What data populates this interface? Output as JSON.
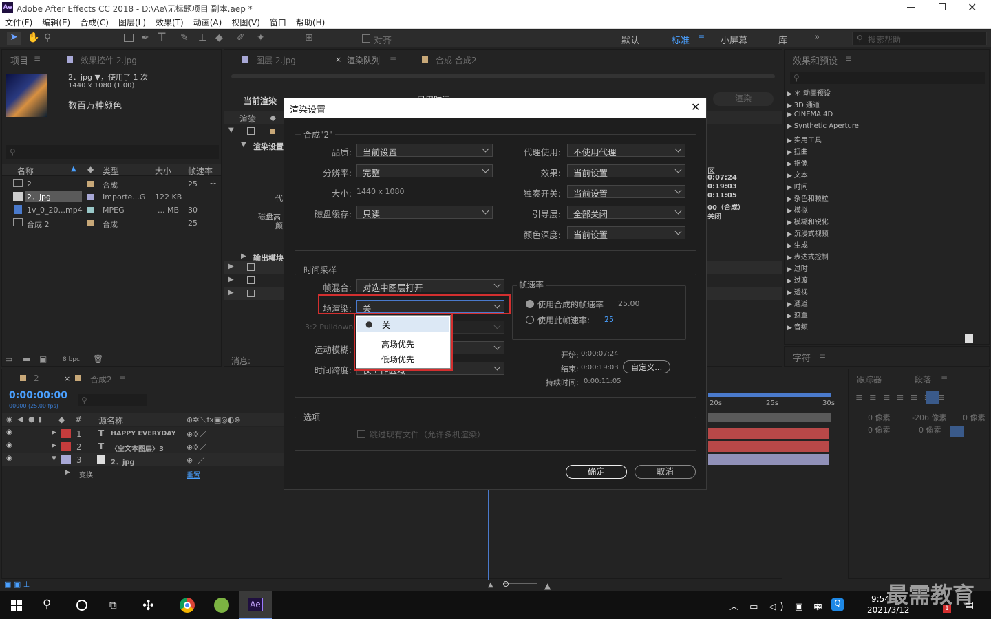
{
  "window": {
    "title": "Adobe After Effects CC 2018 - D:\\Ae\\无标题项目 副本.aep *",
    "app_icon": "Ae"
  },
  "menu": [
    "文件(F)",
    "编辑(E)",
    "合成(C)",
    "图层(L)",
    "效果(T)",
    "动画(A)",
    "视图(V)",
    "窗口",
    "帮助(H)"
  ],
  "toolbar": {
    "align_label": "对齐",
    "workspaces": [
      "默认",
      "标准",
      "小屏幕",
      "库"
    ],
    "search_placeholder": "搜索帮助"
  },
  "project_panel": {
    "tab": "项目",
    "effects_tab": "效果控件 2.jpg",
    "item_name": "2．jpg ▼，使用了 1 次",
    "item_dims": "1440 x 1080 (1.00)",
    "item_colors": "数百万种颜色",
    "columns": [
      "名称",
      "类型",
      "大小",
      "帧速率"
    ],
    "rows": [
      {
        "name": "2",
        "type": "合成",
        "size": "",
        "fps": "25"
      },
      {
        "name": "2．jpg",
        "type": "Importe...G",
        "size": "122 KB",
        "fps": ""
      },
      {
        "name": "1v_0_20...mp4",
        "type": "MPEG",
        "size": "... MB",
        "fps": "30"
      },
      {
        "name": "合成 2",
        "type": "合成",
        "size": "",
        "fps": "25"
      }
    ],
    "bpc": "8 bpc"
  },
  "center_tabs": {
    "layer": "图层 2.jpg",
    "render_queue": "渲染队列",
    "comp": "合成 合成2"
  },
  "render_queue": {
    "current": "当前渲染",
    "render_col": "渲染",
    "render_settings": "渲染设置",
    "output_module": "输出模块",
    "render_btn": "渲染",
    "elapsed": "已用时间",
    "msg_label": "消息:",
    "proxy": "代",
    "disk": "磁盘高",
    "color": "颜"
  },
  "rq_right": {
    "area": "区",
    "t1": "0:07:24",
    "t2": "0:19:03",
    "t3": "0:11:05",
    "t4": "00（合成）",
    "t5": "关闭"
  },
  "effects_panel": {
    "tab": "效果和预设",
    "items": [
      "＊ 动画预设",
      "3D 通道",
      "CINEMA 4D",
      "Synthetic Aperture",
      "实用工具",
      "扭曲",
      "抠像",
      "文本",
      "时间",
      "杂色和颗粒",
      "模拟",
      "模糊和锐化",
      "沉浸式视频",
      "生成",
      "表达式控制",
      "过时",
      "过渡",
      "透视",
      "通道",
      "遮罩",
      "音频"
    ]
  },
  "character_tab": "字符",
  "tracker_tab": "跟踪器",
  "paragraph_tab": "段落",
  "paragraph": {
    "px1": "0 像素",
    "px2": "-206 像素",
    "px3": "0 像素",
    "px4": "0 像素",
    "px5": "0 像素"
  },
  "timeline": {
    "tab": "合成2",
    "tab2": "2",
    "timecode": "0:00:00:00",
    "timecode_sub": "00000 (25.00 fps)",
    "col_name": "源名称",
    "col_num": "#",
    "layers": [
      {
        "num": "1",
        "name": "HAPPY EVERYDAY",
        "color": "#c43c3c"
      },
      {
        "num": "2",
        "name": "〈空文本图层〉3",
        "color": "#c43c3c"
      },
      {
        "num": "3",
        "name": "2．jpg",
        "color": "#a8a8d6"
      }
    ],
    "transform": "变换",
    "reset": "重置",
    "ruler": [
      "20s",
      "25s",
      "30s"
    ]
  },
  "dialog": {
    "title": "渲染设置",
    "comp_group": "合成\"2\"",
    "quality_label": "品质:",
    "quality_value": "当前设置",
    "resolution_label": "分辨率:",
    "resolution_value": "完整",
    "size_label": "大小:",
    "size_value": "1440 x 1080",
    "disk_cache_label": "磁盘缓存:",
    "disk_cache_value": "只读",
    "proxy_label": "代理使用:",
    "proxy_value": "不使用代理",
    "effects_label": "效果:",
    "effects_value": "当前设置",
    "solo_label": "独奏开关:",
    "solo_value": "当前设置",
    "guide_label": "引导层:",
    "guide_value": "全部关闭",
    "depth_label": "颜色深度:",
    "depth_value": "当前设置",
    "time_group": "时间采样",
    "frame_blend_label": "帧混合:",
    "frame_blend_value": "对选中图层打开",
    "field_label": "场渲染:",
    "field_value": "关",
    "pulldown_label": "3:2 Pulldown:",
    "motion_blur_label": "运动模糊:",
    "time_span_label": "时间跨度:",
    "time_span_value": "仅工作区域",
    "field_options": [
      "关",
      "高场优先",
      "低场优先"
    ],
    "fps_group": "帧速率",
    "fps_comp_label": "使用合成的帧速率",
    "fps_comp_value": "25.00",
    "fps_this_label": "使用此帧速率:",
    "fps_this_value": "25",
    "start_label": "开始:",
    "start_value": "0:00:07:24",
    "end_label": "结束:",
    "end_value": "0:00:19:03",
    "duration_label": "持续时间:",
    "duration_value": "0:00:11:05",
    "custom_btn": "自定义...",
    "options_group": "选项",
    "skip_label": "跳过现有文件（允许多机渲染）",
    "ok": "确定",
    "cancel": "取消"
  },
  "taskbar": {
    "time": "9:54",
    "date": "2021/3/12",
    "ime": "中",
    "watermark": "最需教育",
    "badge": "1"
  }
}
